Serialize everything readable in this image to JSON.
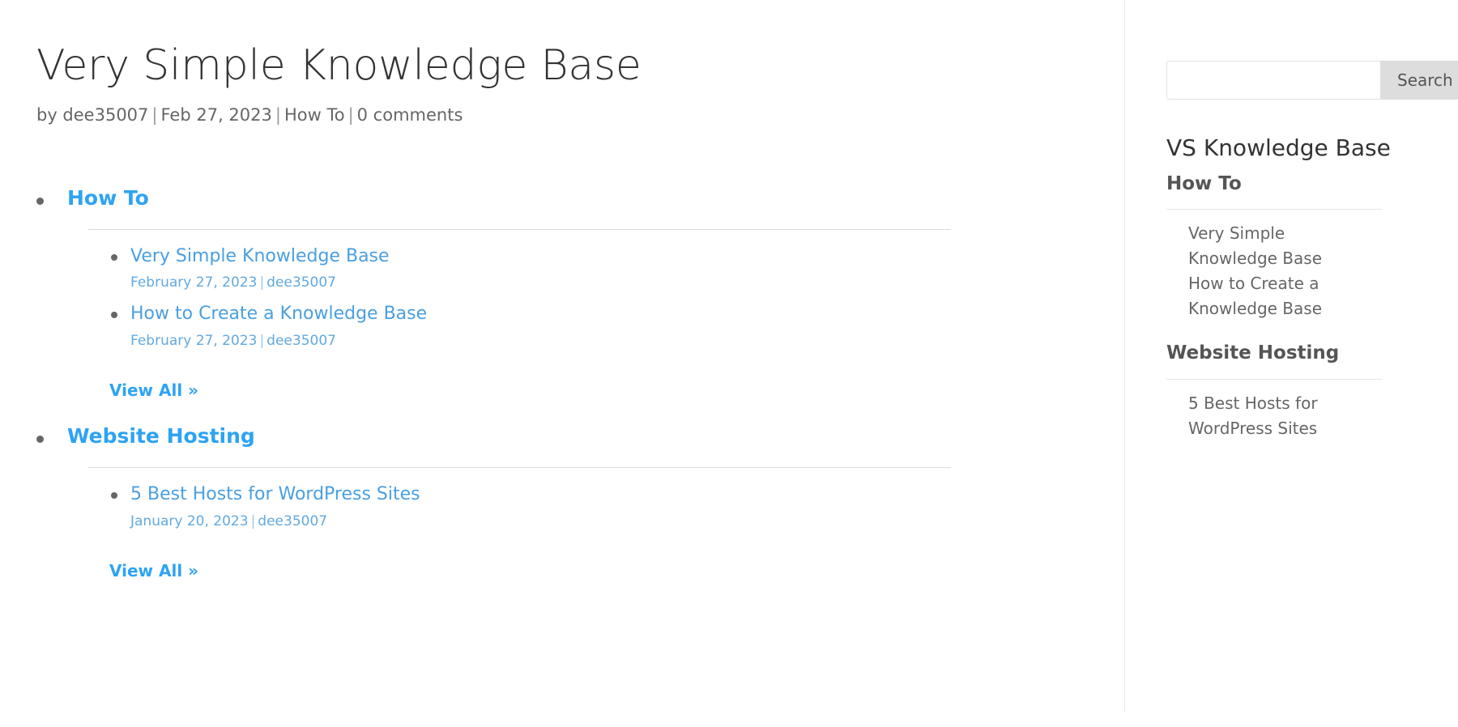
{
  "post": {
    "title": "Very Simple Knowledge Base",
    "meta": {
      "by_author": "by dee35007",
      "date": "Feb 27, 2023",
      "category": "How To",
      "comments": "0 comments",
      "separator": "|"
    }
  },
  "knowledge_base": {
    "categories": [
      {
        "title": "How To",
        "view_all_label": "View All »",
        "posts": [
          {
            "title": "Very Simple Knowledge Base",
            "date": "February 27, 2023",
            "author": "dee35007",
            "separator": "|"
          },
          {
            "title": "How to Create a Knowledge Base",
            "date": "February 27, 2023",
            "author": "dee35007",
            "separator": "|"
          }
        ]
      },
      {
        "title": "Website Hosting",
        "view_all_label": "View All »",
        "posts": [
          {
            "title": "5 Best Hosts for WordPress Sites",
            "date": "January 20, 2023",
            "author": "dee35007",
            "separator": "|"
          }
        ]
      }
    ]
  },
  "sidebar": {
    "search": {
      "value": "",
      "placeholder": "",
      "button_label": "Search"
    },
    "widget": {
      "title": "VS Knowledge Base",
      "groups": [
        {
          "title": "How To",
          "links": [
            "Very Simple Knowledge Base",
            "How to Create a Knowledge Base"
          ]
        },
        {
          "title": "Website Hosting",
          "links": [
            "5 Best Hosts for WordPress Sites"
          ]
        }
      ]
    }
  },
  "colors": {
    "accent_blue": "#2EA3F2",
    "link_blue": "#4A9FE0",
    "heading_dark": "#333333",
    "body_grey": "#666666",
    "rule_grey": "#dcdcdc",
    "button_grey": "#dddddd"
  }
}
